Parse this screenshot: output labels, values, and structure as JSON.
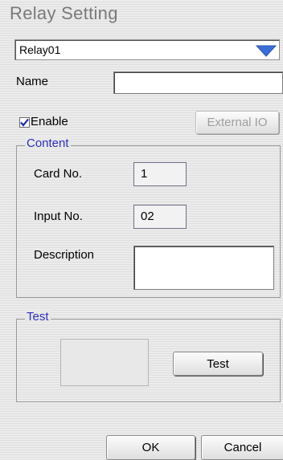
{
  "window": {
    "title": "Relay Setting"
  },
  "relay_select": {
    "value": "Relay01"
  },
  "name": {
    "label": "Name",
    "value": ""
  },
  "enable": {
    "label": "Enable",
    "checked": true
  },
  "external_io": {
    "label": "External IO"
  },
  "content": {
    "legend": "Content",
    "card_no": {
      "label": "Card No.",
      "value": "1"
    },
    "input_no": {
      "label": "Input No.",
      "value": "02"
    },
    "description": {
      "label": "Description",
      "value": ""
    }
  },
  "test": {
    "legend": "Test",
    "button_label": "Test"
  },
  "footer": {
    "ok_label": "OK",
    "cancel_label": "Cancel"
  },
  "colors": {
    "legend_text": "#2d2dbb",
    "dropdown_arrow": "#3a6fd8",
    "check": "#1f2aa8"
  }
}
